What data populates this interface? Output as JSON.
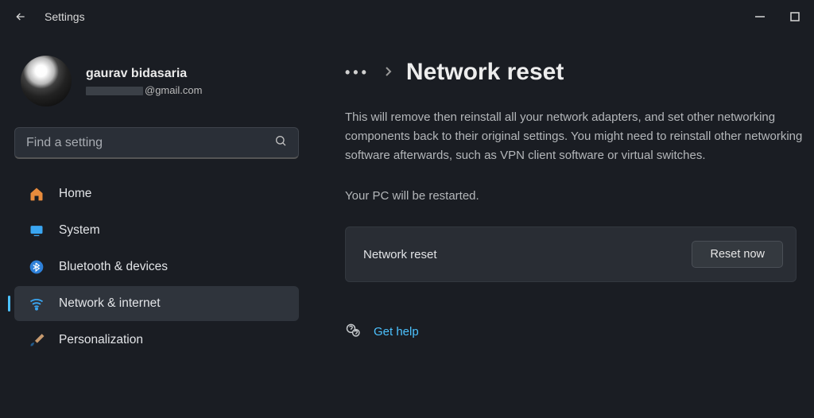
{
  "title": "Settings",
  "profile": {
    "name": "gaurav bidasaria",
    "email_suffix": "@gmail.com"
  },
  "search": {
    "placeholder": "Find a setting"
  },
  "sidebar": {
    "items": [
      {
        "label": "Home"
      },
      {
        "label": "System"
      },
      {
        "label": "Bluetooth & devices"
      },
      {
        "label": "Network & internet"
      },
      {
        "label": "Personalization"
      }
    ]
  },
  "breadcrumb": {
    "dots": "•••",
    "page_title": "Network reset"
  },
  "main": {
    "description": "This will remove then reinstall all your network adapters, and set other networking components back to their original settings. You might need to reinstall other networking software afterwards, such as VPN client software or virtual switches.",
    "restart_notice": "Your PC will be restarted.",
    "card_label": "Network reset",
    "reset_button": "Reset now",
    "get_help": "Get help"
  }
}
